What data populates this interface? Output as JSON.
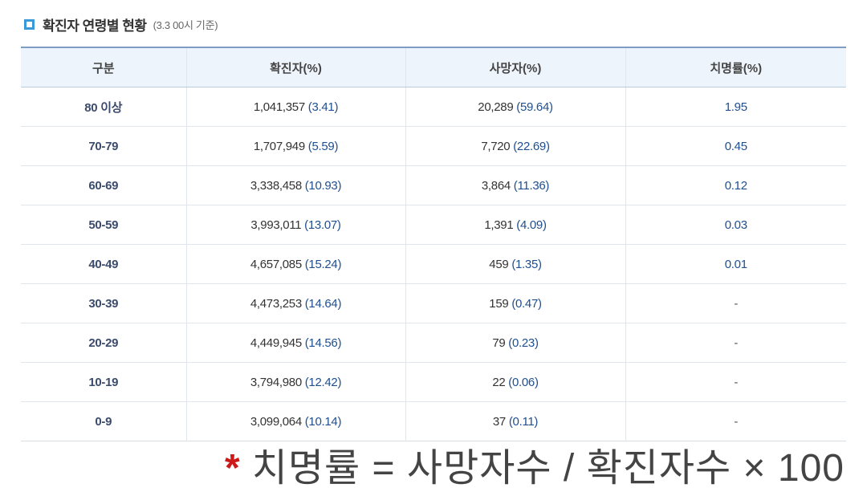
{
  "section": {
    "title": "확진자 연령별 현황",
    "note": "(3.3 00시 기준)"
  },
  "table": {
    "headers": [
      "구분",
      "확진자(%)",
      "사망자(%)",
      "치명률(%)"
    ],
    "rows": [
      {
        "age": "80 이상",
        "confirmed": "1,041,357",
        "confirmed_pct": "(3.41)",
        "deaths": "20,289",
        "deaths_pct": "(59.64)",
        "rate": "1.95"
      },
      {
        "age": "70-79",
        "confirmed": "1,707,949",
        "confirmed_pct": "(5.59)",
        "deaths": "7,720",
        "deaths_pct": "(22.69)",
        "rate": "0.45"
      },
      {
        "age": "60-69",
        "confirmed": "3,338,458",
        "confirmed_pct": "(10.93)",
        "deaths": "3,864",
        "deaths_pct": "(11.36)",
        "rate": "0.12"
      },
      {
        "age": "50-59",
        "confirmed": "3,993,011",
        "confirmed_pct": "(13.07)",
        "deaths": "1,391",
        "deaths_pct": "(4.09)",
        "rate": "0.03"
      },
      {
        "age": "40-49",
        "confirmed": "4,657,085",
        "confirmed_pct": "(15.24)",
        "deaths": "459",
        "deaths_pct": "(1.35)",
        "rate": "0.01"
      },
      {
        "age": "30-39",
        "confirmed": "4,473,253",
        "confirmed_pct": "(14.64)",
        "deaths": "159",
        "deaths_pct": "(0.47)",
        "rate": "-"
      },
      {
        "age": "20-29",
        "confirmed": "4,449,945",
        "confirmed_pct": "(14.56)",
        "deaths": "79",
        "deaths_pct": "(0.23)",
        "rate": "-"
      },
      {
        "age": "10-19",
        "confirmed": "3,794,980",
        "confirmed_pct": "(12.42)",
        "deaths": "22",
        "deaths_pct": "(0.06)",
        "rate": "-"
      },
      {
        "age": "0-9",
        "confirmed": "3,099,064",
        "confirmed_pct": "(10.14)",
        "deaths": "37",
        "deaths_pct": "(0.11)",
        "rate": "-"
      }
    ]
  },
  "formula": {
    "star": "*",
    "text": "치명률 = 사망자수 / 확진자수 × 100"
  },
  "colors": {
    "accent": "#3a9ad9",
    "header_bg": "#eef4fb",
    "value_blue": "#1f4f8f",
    "star_red": "#cc1a1a"
  }
}
